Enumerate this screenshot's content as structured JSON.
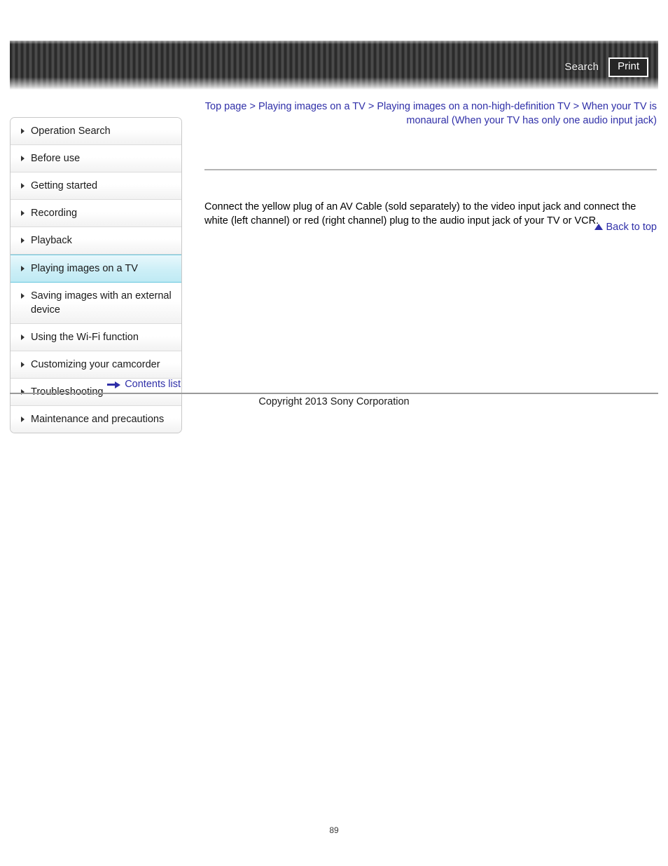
{
  "header": {
    "search_label": "Search",
    "print_label": "Print"
  },
  "breadcrumb": {
    "text": "Top page > Playing images on a TV > Playing images on a non-high-definition TV > When your TV is monaural (When your TV has only one audio input jack)"
  },
  "sidebar": {
    "items": [
      {
        "label": "Operation Search",
        "active": false
      },
      {
        "label": "Before use",
        "active": false
      },
      {
        "label": "Getting started",
        "active": false
      },
      {
        "label": "Recording",
        "active": false
      },
      {
        "label": "Playback",
        "active": false
      },
      {
        "label": "Playing images on a TV",
        "active": true
      },
      {
        "label": "Saving images with an external device",
        "active": false
      },
      {
        "label": "Using the Wi-Fi function",
        "active": false
      },
      {
        "label": "Customizing your camcorder",
        "active": false
      },
      {
        "label": "Troubleshooting",
        "active": false
      },
      {
        "label": "Maintenance and precautions",
        "active": false
      }
    ],
    "contents_list_label": "Contents list"
  },
  "main": {
    "paragraph": "Connect the yellow plug of an AV Cable (sold separately) to the video input jack and connect the white (left channel) or red (right channel) plug to the audio input jack of your TV or VCR.",
    "back_to_top_label": "Back to top"
  },
  "footer": {
    "copyright": "Copyright 2013 Sony Corporation",
    "page_number": "89"
  },
  "colors": {
    "link_blue": "#2f2fa8",
    "active_nav_cyan": "#cdeff7",
    "header_dark": "#2b2b2b",
    "rule_gray": "#b4b4b4"
  }
}
